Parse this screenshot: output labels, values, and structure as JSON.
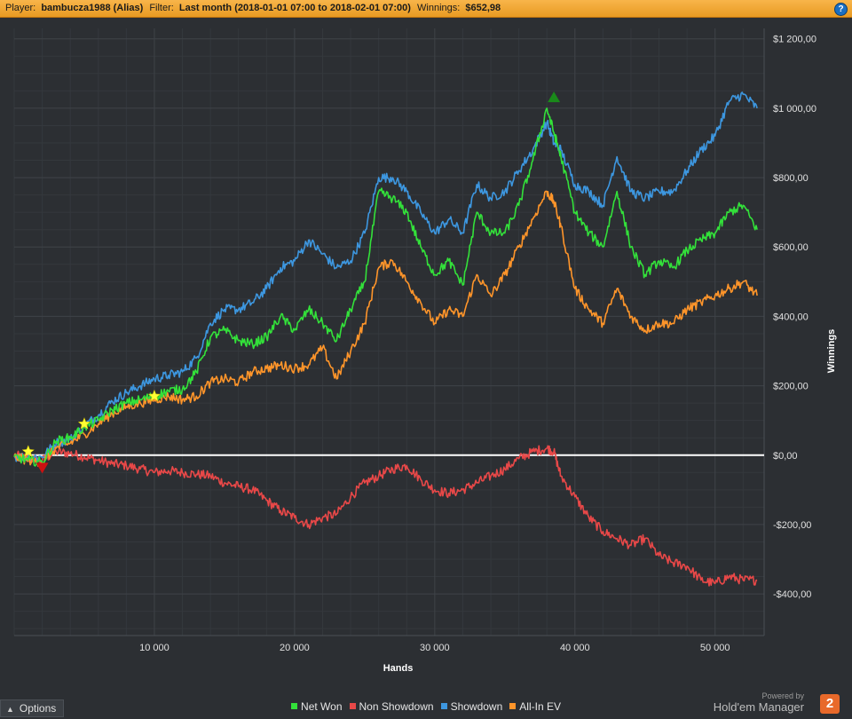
{
  "header": {
    "player_label": "Player:",
    "player_value": "bambucza1988 (Alias)",
    "filter_label": "Filter:",
    "filter_value": "Last month (2018-01-01 07:00 to 2018-02-01 07:00)",
    "winnings_label": "Winnings:",
    "winnings_value": "$652,98",
    "help_icon": "?"
  },
  "footer": {
    "options_label": "Options",
    "powered_by": "Powered by",
    "brand": "Hold'em Manager",
    "brand_logo": "2"
  },
  "colors": {
    "background": "#2c2f33",
    "grid": "#3e4247",
    "zero_line": "#ffffff",
    "net_won": "#33e13a",
    "non_showdown": "#e84848",
    "showdown": "#3d97e0",
    "all_in_ev": "#ff952a",
    "header": "#f4a93a"
  },
  "chart_data": {
    "type": "line",
    "title": "",
    "xlabel": "Hands",
    "ylabel": "Winnings",
    "xlim": [
      0,
      53500
    ],
    "ylim": [
      -520,
      1230
    ],
    "x_ticks": [
      10000,
      20000,
      30000,
      40000,
      50000
    ],
    "x_tick_labels": [
      "10 000",
      "20 000",
      "30 000",
      "40 000",
      "50 000"
    ],
    "y_ticks": [
      1200,
      1000,
      800,
      600,
      400,
      200,
      0,
      -200,
      -400
    ],
    "y_tick_labels": [
      "$1 200,00",
      "$1 000,00",
      "$800,00",
      "$600,00",
      "$400,00",
      "$200,00",
      "$0,00",
      "-$200,00",
      "-$400,00"
    ],
    "y_axis_side": "right",
    "grid": true,
    "legend_position": "bottom-center",
    "series": [
      {
        "name": "Net Won",
        "color": "#33e13a",
        "x": [
          0,
          1000,
          2000,
          3000,
          4000,
          5000,
          6000,
          7000,
          8000,
          9000,
          10000,
          11000,
          12000,
          13000,
          14000,
          15000,
          16000,
          17000,
          18000,
          19000,
          20000,
          21000,
          22000,
          23000,
          24000,
          25000,
          26000,
          27000,
          28000,
          29000,
          30000,
          31000,
          32000,
          33000,
          34000,
          35000,
          36000,
          37000,
          38000,
          38500,
          39000,
          40000,
          41000,
          42000,
          43000,
          44000,
          45000,
          46000,
          47000,
          48000,
          49000,
          50000,
          51000,
          52000,
          53000
        ],
        "y": [
          -5,
          -15,
          -20,
          40,
          50,
          80,
          100,
          130,
          150,
          160,
          170,
          185,
          190,
          240,
          340,
          360,
          330,
          320,
          340,
          400,
          360,
          420,
          380,
          330,
          420,
          500,
          760,
          740,
          700,
          600,
          520,
          560,
          490,
          700,
          640,
          640,
          720,
          850,
          1000,
          930,
          860,
          700,
          640,
          600,
          760,
          600,
          520,
          560,
          540,
          590,
          620,
          640,
          700,
          720,
          650
        ]
      },
      {
        "name": "Non Showdown",
        "color": "#e84848",
        "x": [
          0,
          1000,
          2000,
          3000,
          4000,
          5000,
          6000,
          7000,
          8000,
          9000,
          10000,
          11000,
          12000,
          13000,
          14000,
          15000,
          16000,
          17000,
          18000,
          19000,
          20000,
          21000,
          22000,
          23000,
          24000,
          25000,
          26000,
          27000,
          28000,
          29000,
          30000,
          31000,
          32000,
          33000,
          34000,
          35000,
          36000,
          37000,
          38000,
          38500,
          39000,
          40000,
          41000,
          42000,
          43000,
          44000,
          45000,
          46000,
          47000,
          48000,
          49000,
          50000,
          51000,
          52000,
          53000
        ],
        "y": [
          0,
          -10,
          -15,
          10,
          5,
          -5,
          -15,
          -25,
          -30,
          -40,
          -50,
          -45,
          -50,
          -55,
          -60,
          -80,
          -90,
          -100,
          -130,
          -160,
          -180,
          -200,
          -180,
          -170,
          -120,
          -80,
          -60,
          -40,
          -30,
          -70,
          -100,
          -110,
          -100,
          -80,
          -60,
          -40,
          -10,
          10,
          20,
          10,
          -60,
          -120,
          -180,
          -220,
          -240,
          -260,
          -240,
          -290,
          -310,
          -320,
          -360,
          -370,
          -350,
          -360,
          -360
        ]
      },
      {
        "name": "Showdown",
        "color": "#3d97e0",
        "x": [
          0,
          1000,
          2000,
          3000,
          4000,
          5000,
          6000,
          7000,
          8000,
          9000,
          10000,
          11000,
          12000,
          13000,
          14000,
          15000,
          16000,
          17000,
          18000,
          19000,
          20000,
          21000,
          22000,
          23000,
          24000,
          25000,
          26000,
          27000,
          28000,
          29000,
          30000,
          31000,
          32000,
          33000,
          34000,
          35000,
          36000,
          37000,
          38000,
          38500,
          39000,
          40000,
          41000,
          42000,
          43000,
          44000,
          45000,
          46000,
          47000,
          48000,
          49000,
          50000,
          51000,
          52000,
          53000
        ],
        "y": [
          -5,
          -5,
          -5,
          35,
          45,
          85,
          115,
          155,
          180,
          200,
          220,
          230,
          240,
          280,
          380,
          420,
          420,
          440,
          480,
          540,
          560,
          620,
          580,
          540,
          560,
          640,
          800,
          800,
          760,
          700,
          640,
          680,
          640,
          780,
          740,
          760,
          820,
          880,
          960,
          900,
          880,
          780,
          760,
          720,
          860,
          760,
          740,
          760,
          760,
          820,
          880,
          920,
          1020,
          1040,
          1000
        ]
      },
      {
        "name": "All-In EV",
        "color": "#ff952a",
        "x": [
          0,
          1000,
          2000,
          3000,
          4000,
          5000,
          6000,
          7000,
          8000,
          9000,
          10000,
          11000,
          12000,
          13000,
          14000,
          15000,
          16000,
          17000,
          18000,
          19000,
          20000,
          21000,
          22000,
          23000,
          24000,
          25000,
          26000,
          27000,
          28000,
          29000,
          30000,
          31000,
          32000,
          33000,
          34000,
          35000,
          36000,
          37000,
          38000,
          38500,
          39000,
          40000,
          41000,
          42000,
          43000,
          44000,
          45000,
          46000,
          47000,
          48000,
          49000,
          50000,
          51000,
          52000,
          53000
        ],
        "y": [
          -5,
          -15,
          -20,
          20,
          35,
          60,
          90,
          120,
          140,
          150,
          160,
          170,
          160,
          170,
          210,
          220,
          210,
          240,
          250,
          260,
          250,
          260,
          310,
          220,
          300,
          380,
          540,
          560,
          500,
          440,
          380,
          420,
          400,
          520,
          460,
          520,
          600,
          680,
          760,
          730,
          660,
          480,
          420,
          380,
          480,
          400,
          360,
          380,
          380,
          420,
          440,
          460,
          480,
          500,
          460
        ]
      }
    ],
    "markers": [
      {
        "type": "star",
        "x": 1000,
        "y": 10,
        "color": "#ffff33"
      },
      {
        "type": "star",
        "x": 5000,
        "y": 90,
        "color": "#ffff33"
      },
      {
        "type": "star",
        "x": 10000,
        "y": 170,
        "color": "#ffff33"
      },
      {
        "type": "triangle-down",
        "x": 2000,
        "y": -35,
        "color": "#cc1111"
      },
      {
        "type": "triangle-up",
        "x": 38500,
        "y": 1030,
        "color": "#1a8a1a"
      }
    ]
  }
}
